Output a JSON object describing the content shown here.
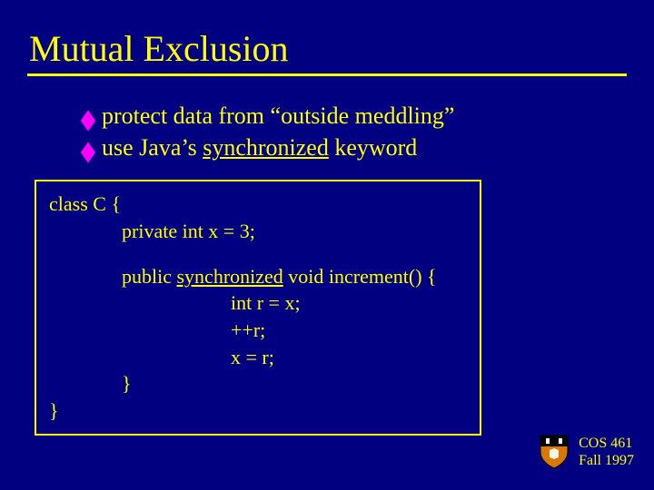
{
  "title": "Mutual Exclusion",
  "bullets": [
    {
      "pre": "protect data from ",
      "quoted": "“outside meddling”",
      "post": ""
    },
    {
      "pre": "use Java’s ",
      "underlined": "synchronized",
      "post": " keyword"
    }
  ],
  "code": {
    "l1": "class C {",
    "l2": "private int x = 3;",
    "l3a": "public ",
    "l3u": "synchronized",
    "l3b": " void increment() {",
    "l4": "int r = x;",
    "l5": "++r;",
    "l6": "x = r;",
    "l7": "}",
    "l8": "}"
  },
  "footer": {
    "line1": "COS 461",
    "line2": "Fall 1997"
  }
}
